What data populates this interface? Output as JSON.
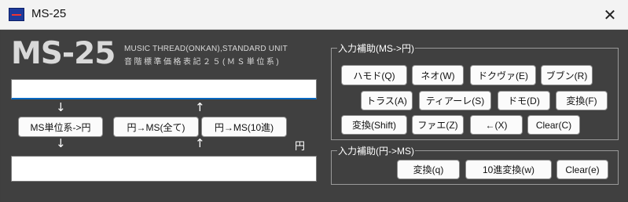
{
  "window": {
    "title": "MS-25",
    "close": "✕"
  },
  "logo": {
    "main": "MS-25",
    "subtitle1": "MUSIC THREAD(ONKAN),STANDARD UNIT",
    "subtitle2": "音階標準価格表記２５(ＭＳ単位系)"
  },
  "converter": {
    "input_value": "",
    "output_value": "",
    "arrow_down": "↓",
    "arrow_up": "↑",
    "buttons": [
      "MS単位系->円",
      "円→MS(全て)",
      "円→MS(10進)"
    ],
    "unit_label": "円"
  },
  "group1": {
    "title": "入力補助(MS->円)",
    "buttons": [
      "ハモド(Q)",
      "ネオ(W)",
      "ドクヴァ(E)",
      "ブブン(R)",
      "トラス(A)",
      "ティアーレ(S)",
      "ドモ(D)",
      "変換(F)",
      "変換(Shift)",
      "ファエ(Z)",
      "←(X)",
      "Clear(C)"
    ]
  },
  "group2": {
    "title": "入力補助(円->MS)",
    "buttons": [
      "変換(q)",
      "10進変換(w)",
      "Clear(e)"
    ]
  }
}
